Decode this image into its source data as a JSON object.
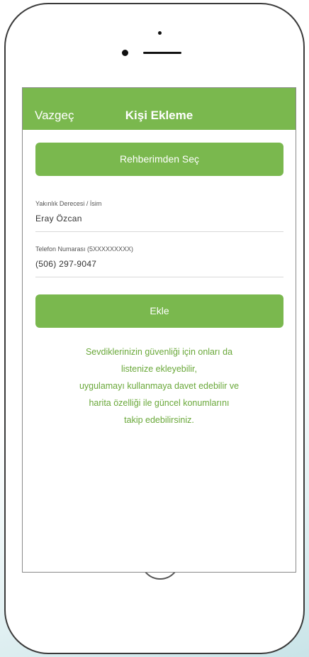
{
  "nav": {
    "cancel": "Vazgeç",
    "title": "Kişi Ekleme"
  },
  "buttons": {
    "select_from_contacts": "Rehberimden Seç",
    "add": "Ekle"
  },
  "form": {
    "name_label": "Yakınlık Derecesi / İsim",
    "name_value": "Eray Özcan",
    "phone_label": "Telefon Numarası (5XXXXXXXXX)",
    "phone_value": "(506) 297-9047"
  },
  "info_lines": [
    "Sevdiklerinizin güvenliği için onları da",
    "listenize ekleyebilir,",
    "uygulamayı kullanmaya davet edebilir ve",
    "harita özelliği ile güncel konumlarını",
    "takip edebilirsiniz."
  ],
  "colors": {
    "accent": "#7ab84e",
    "info_text": "#6aa83a"
  }
}
